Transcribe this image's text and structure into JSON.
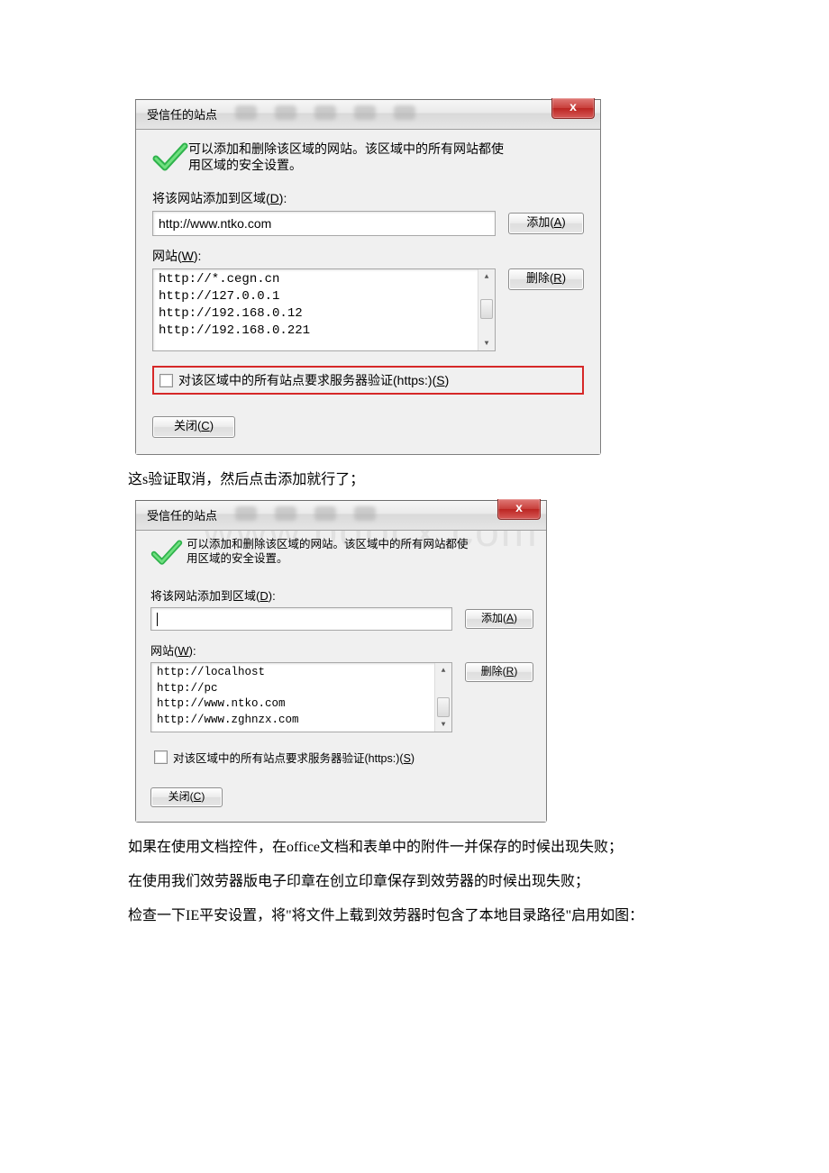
{
  "dialog1": {
    "title": "受信任的站点",
    "infoLine1": "可以添加和删除该区域的网站。该区域中的所有网站都使",
    "infoLine2": "用区域的安全设置。",
    "addZoneLabel": "将该网站添加到区域(D):",
    "inputValue": "http://www.ntko.com",
    "addBtn": "添加(A)",
    "sitesLabel": "网站(W):",
    "listItems": [
      "http://*.cegn.cn",
      "http://127.0.0.1",
      "http://192.168.0.12",
      "http://192.168.0.221"
    ],
    "removeBtn": "删除(R)",
    "checkboxLabel": "对该区域中的所有站点要求服务器验证(https:)(S)",
    "closeBtn": "关闭(C)",
    "closeX": "x"
  },
  "paragraphA": "这s验证取消，然后点击添加就行了；",
  "dialog2": {
    "title": "受信任的站点",
    "infoLine1": "可以添加和删除该区域的网站。该区域中的所有网站都使",
    "infoLine2": "用区域的安全设置。",
    "addZoneLabel": "将该网站添加到区域(D):",
    "inputValue": "",
    "addBtn": "添加(A)",
    "sitesLabel": "网站(W):",
    "listItems": [
      "http://localhost",
      "http://pc",
      "http://www.ntko.com",
      "http://www.zghnzx.com"
    ],
    "removeBtn": "删除(R)",
    "checkboxLabel": "对该区域中的所有站点要求服务器验证(https:)(S)",
    "closeBtn": "关闭(C)",
    "closeX": "x"
  },
  "watermark": "www.bdocx.com",
  "paragraphB": "如果在使用文档控件，在office文档和表单中的附件一并保存的时候出现失败；",
  "paragraphC": "在使用我们效劳器版电子印章在创立印章保存到效劳器的时候出现失败；",
  "paragraphD": "检查一下IE平安设置，将\"将文件上载到效劳器时包含了本地目录路径\"启用如图："
}
